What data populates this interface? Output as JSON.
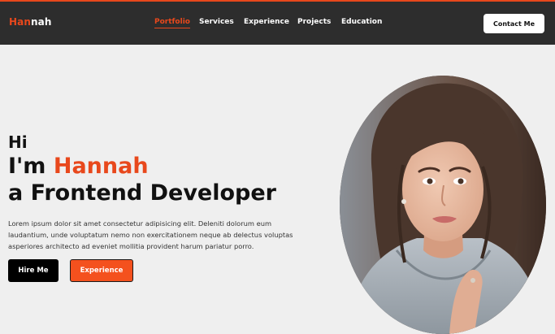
{
  "logo": {
    "accent": "Han",
    "rest": "nah"
  },
  "nav": {
    "items": [
      {
        "label": "Portfolio",
        "active": true
      },
      {
        "label": "Services"
      },
      {
        "label": "Experience"
      },
      {
        "label": "Projects"
      },
      {
        "label": "Education"
      }
    ],
    "contact_label": "Contact Me"
  },
  "hero": {
    "greeting": "Hi",
    "intro": "I'm",
    "name": "Hannah",
    "role": "a Frontend Developer",
    "description": "Lorem ipsum dolor sit amet consectetur adipisicing elit. Deleniti dolorum eum laudantium, unde voluptatum nemo non exercitationem neque ab delectus voluptas asperiores architecto ad eveniet mollitia provident harum pariatur porro.",
    "hire_label": "Hire Me",
    "experience_label": "Experience"
  },
  "colors": {
    "accent": "#e8481c",
    "navbar": "#2d2d2d",
    "background": "#efefef"
  },
  "icons": {
    "portrait": "profile-photo"
  }
}
